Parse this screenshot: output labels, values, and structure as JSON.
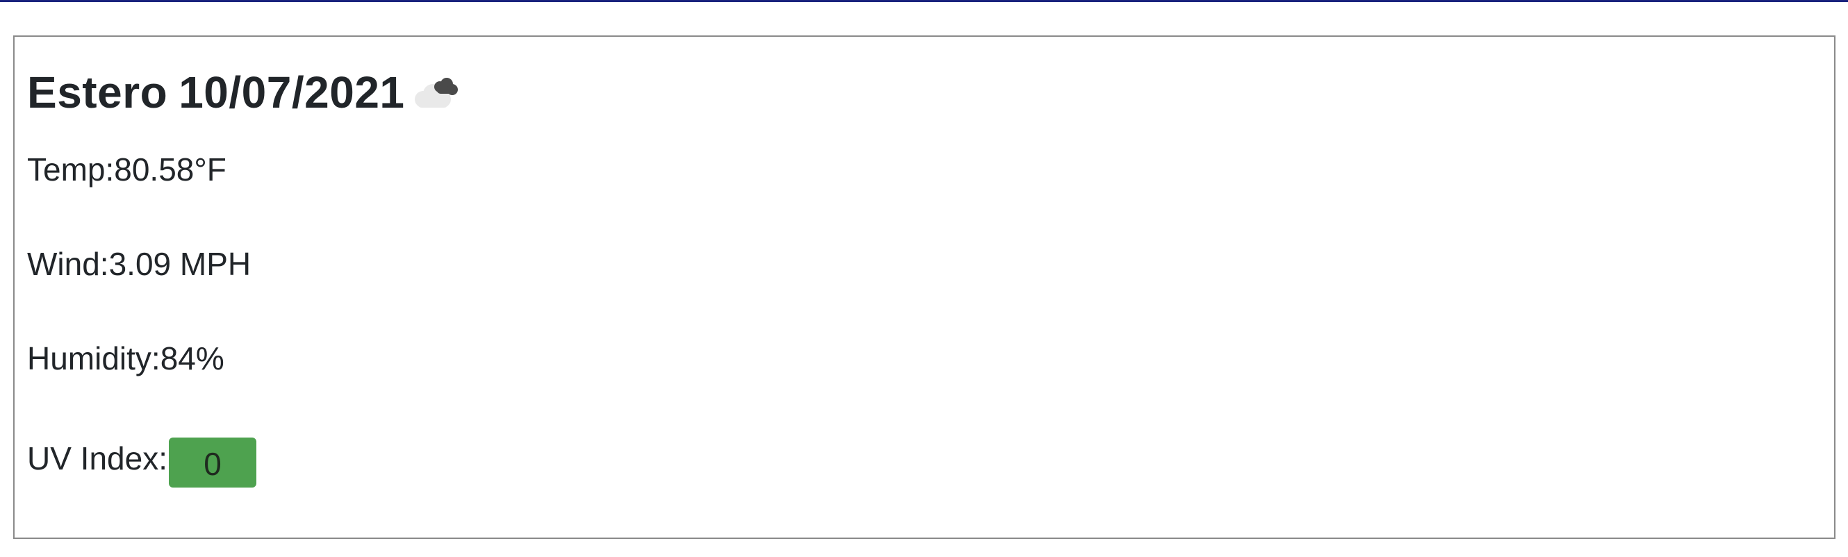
{
  "weather": {
    "city": "Estero",
    "date": "10/07/2021",
    "icon": "broken-clouds-icon",
    "temp_label": "Temp:",
    "temp_value": "80.58°F",
    "wind_label": "Wind:",
    "wind_value": "3.09 MPH",
    "humidity_label": "Humidity:",
    "humidity_value": "84%",
    "uv_label": "UV Index:",
    "uv_value": "0",
    "uv_color": "#4ea24f"
  },
  "colors": {
    "top_rule": "#1a237e",
    "card_border": "#8a8a8a",
    "text": "#212529"
  }
}
